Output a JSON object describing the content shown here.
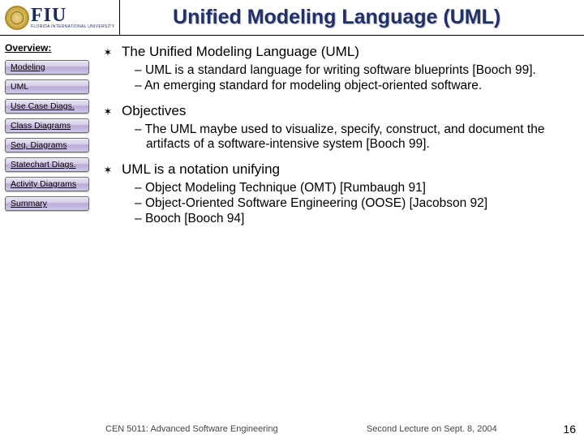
{
  "header": {
    "logo_text": "FIU",
    "logo_sub": "FLORIDA INTERNATIONAL UNIVERSITY",
    "title": "Unified Modeling Language (UML)"
  },
  "sidebar": {
    "heading": "Overview:",
    "items": [
      {
        "label": "Modeling"
      },
      {
        "label": "UML"
      },
      {
        "label": "Use Case Diags."
      },
      {
        "label": "Class Diagrams"
      },
      {
        "label": "Seq. Diagrams"
      },
      {
        "label": "Statechart Diags."
      },
      {
        "label": "Activity Diagrams"
      },
      {
        "label": "Summary"
      }
    ]
  },
  "content": {
    "items": [
      {
        "title": "The Unified Modeling Language (UML)",
        "subs": [
          "UML is a standard language for writing software blueprints [Booch 99].",
          "An emerging standard for modeling object-oriented software."
        ]
      },
      {
        "title": "Objectives",
        "subs": [
          "The UML maybe used to visualize, specify, construct, and document the artifacts of a software-intensive system [Booch 99]."
        ]
      },
      {
        "title": "UML is a notation unifying",
        "subs": [
          "Object Modeling Technique (OMT) [Rumbaugh 91]",
          "Object-Oriented Software Engineering (OOSE) [Jacobson 92]",
          "Booch [Booch 94]"
        ]
      }
    ]
  },
  "footer": {
    "left": "CEN 5011: Advanced Software Engineering",
    "mid": "Second Lecture on Sept. 8, 2004",
    "page": "16"
  }
}
